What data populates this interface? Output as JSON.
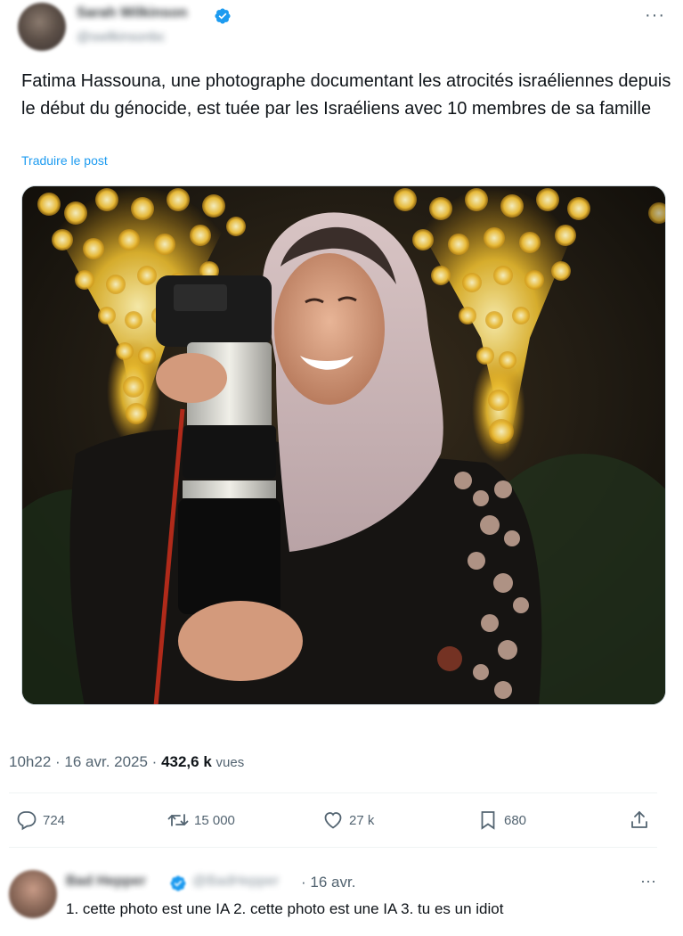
{
  "post": {
    "author_name": "Sarah Wilkinson",
    "author_handle": "@swilkinsonbc",
    "more_label": "···",
    "text": "Fatima Hassouna, une photographe documentant les atrocités israéliennes depuis le début du génocide, est tuée par les Israéliens avec 10 membres de sa famille",
    "translate_label": "Traduire le post",
    "timestamp": "10h22 · 16 avr. 2025 · ",
    "views_count": "432,6 k",
    "views_label": "vues"
  },
  "actions": {
    "replies": "724",
    "reposts": "15 000",
    "likes": "27 k",
    "bookmarks": "680"
  },
  "reply": {
    "author_name": "Bad Hepper",
    "author_handle": "@BadHepper",
    "date": "· 16 avr.",
    "more_label": "···",
    "text": "1. cette photo est une IA 2. cette photo est une IA 3. tu es un idiot"
  },
  "colors": {
    "accent": "#1d9bf0",
    "text": "#0f1419",
    "secondary": "#536471"
  }
}
